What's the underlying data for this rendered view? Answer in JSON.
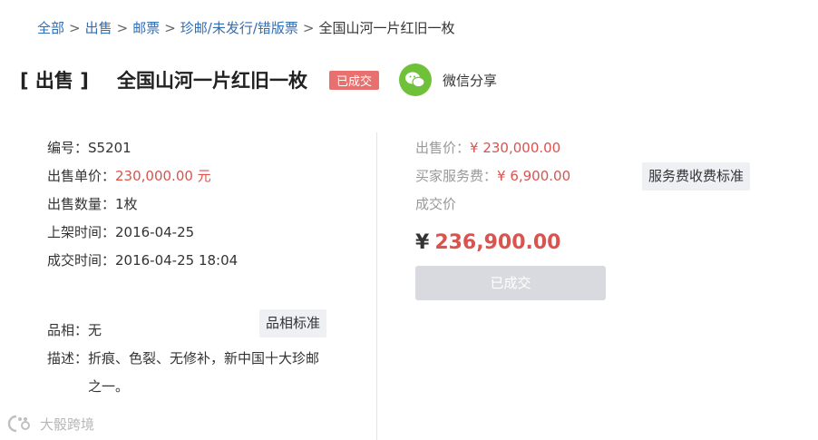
{
  "breadcrumb": {
    "items": [
      "全部",
      "出售",
      "邮票",
      "珍邮/未发行/错版票"
    ],
    "sep": ">",
    "current": "全国山河一片红旧一枚"
  },
  "title": {
    "prefix": "[ 出售 ]",
    "text": "全国山河一片红旧一枚",
    "status": "已成交",
    "share_label": "微信分享"
  },
  "details": {
    "serial": "编号：S5201",
    "unit_price_label": "出售单价：",
    "unit_price_value": "230,000.00 元",
    "quantity": "出售数量：1枚",
    "list_time": "上架时间：2016-04-25",
    "deal_time": "成交时间：2016-04-25 18:04",
    "condition": "品相：无",
    "condition_std": "品相标准",
    "desc_label": "描述：",
    "desc_value": "折痕、色裂、无修补，新中国十大珍邮之一。"
  },
  "pricing": {
    "sale_price_label": "出售价：",
    "sale_price": "¥ 230,000.00",
    "fee_label": "买家服务费：",
    "fee": "¥ 6,900.00",
    "fee_std": "服务费收费标准",
    "deal_price_label": "成交价",
    "total_symbol": "¥",
    "total": "236,900.00",
    "button": "已成交"
  },
  "watermark": "大骰跨境",
  "colors": {
    "link": "#2f6db6",
    "red": "#d9534f",
    "badge": "#e8706e",
    "wechat": "#6fc13a"
  }
}
